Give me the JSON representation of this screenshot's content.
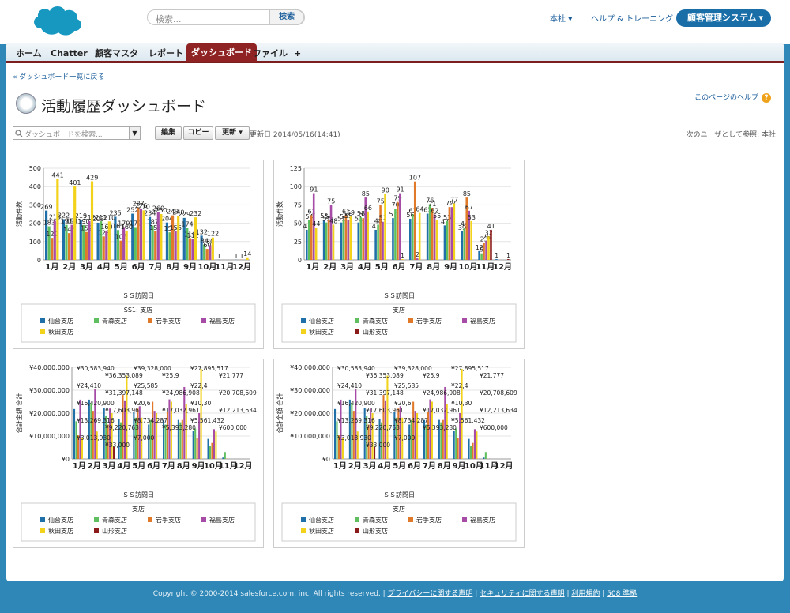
{
  "header": {
    "search_placeholder": "検索...",
    "search_button": "検索",
    "org_menu": "本社",
    "help_link": "ヘルプ & トレーニング",
    "app_switcher": "顧客管理システム"
  },
  "tabs": [
    {
      "label": "ホーム"
    },
    {
      "label": "Chatter"
    },
    {
      "label": "顧客マスタ"
    },
    {
      "label": "レポート"
    },
    {
      "label": "ダッシュボード",
      "active": true
    },
    {
      "label": "ファイル"
    },
    {
      "label": "+"
    }
  ],
  "page": {
    "back_link": "« ダッシュボード一覧に戻る",
    "title": "活動履歴ダッシュボード",
    "help_link": "このページのヘルプ",
    "dash_search_placeholder": "ダッシュボードを検索...",
    "edit_button": "編集",
    "copy_button": "コピー",
    "refresh_button": "更新",
    "updated_text": "更新日 2014/05/16(14:41)",
    "view_as": "次のユーザとして参照: 本社"
  },
  "footer": {
    "copyright": "Copyright © 2000-2014 salesforce.com, inc. All rights reserved.",
    "links": [
      "プライバシーに関する声明",
      "セキュリティに関する声明",
      "利用規約",
      "508 準拠"
    ]
  },
  "colors": {
    "accent": "#8f2323",
    "tab_bar": "#dce8f0",
    "page_bg": "#2f87b7"
  },
  "chart_data": [
    {
      "type": "bar",
      "categories": [
        "1月",
        "2月",
        "3月",
        "4月",
        "5月",
        "6月",
        "7月",
        "8月",
        "9月",
        "10月",
        "11月",
        "12月"
      ],
      "ylabel": "活動件数",
      "xlabel": "ＳＳ訪問日",
      "ylim": [
        0,
        500
      ],
      "yticks": [
        "0",
        "100",
        "200",
        "300",
        "400",
        "500"
      ],
      "legend_title": "SS1: 支店",
      "series": [
        {
          "name": "仙台支店",
          "color": "#1f6fa8",
          "values": [
            269,
            222,
            219,
            203,
            235,
            252,
            234,
            204,
            229,
            132,
            1,
            1
          ]
        },
        {
          "name": "青森支店",
          "color": "#5fbf5f",
          "values": [
            183,
            191,
            190,
            211,
            163,
            179,
            187,
            150,
            174,
            84,
            0,
            0
          ]
        },
        {
          "name": "岩手支店",
          "color": "#e07a2a",
          "values": [
            120,
            146,
            152,
            128,
            105,
            287,
            156,
            243,
            119,
            60,
            0,
            1
          ]
        },
        {
          "name": "福島支店",
          "color": "#a64ca6",
          "values": [
            213,
            191,
            212,
            160,
            179,
            276,
            260,
            156,
            112,
            80,
            0,
            0
          ]
        },
        {
          "name": "秋田支店",
          "color": "#f2d21a",
          "values": [
            441,
            401,
            429,
            210,
            160,
            270,
            250,
            240,
            232,
            122,
            0,
            14
          ]
        }
      ]
    },
    {
      "type": "bar",
      "categories": [
        "1月",
        "2月",
        "3月",
        "4月",
        "5月",
        "6月",
        "7月",
        "8月",
        "9月",
        "10月",
        "11月",
        "12月"
      ],
      "ylabel": "活動件数",
      "xlabel": "ＳＳ訪問日",
      "ylim": [
        0,
        125
      ],
      "yticks": [
        "0",
        "25",
        "50",
        "75",
        "100",
        "125"
      ],
      "legend_title": "支店",
      "series": [
        {
          "name": "仙台支店",
          "color": "#1f6fa8",
          "values": [
            41,
            55,
            51,
            51,
            41,
            57,
            56,
            63,
            47,
            39,
            12,
            1
          ]
        },
        {
          "name": "青森支店",
          "color": "#5fbf5f",
          "values": [
            54,
            51,
            54,
            58,
            48,
            70,
            62,
            76,
            53,
            44,
            9,
            0
          ]
        },
        {
          "name": "岩手支店",
          "color": "#e07a2a",
          "values": [
            61,
            54,
            61,
            57,
            75,
            79,
            107,
            71,
            72,
            85,
            23,
            0
          ]
        },
        {
          "name": "福島支店",
          "color": "#a64ca6",
          "values": [
            91,
            75,
            55,
            85,
            52,
            91,
            2,
            62,
            72,
            67,
            26,
            0
          ]
        },
        {
          "name": "秋田支店",
          "color": "#f2d21a",
          "values": [
            44,
            48,
            59,
            66,
            90,
            1,
            64,
            55,
            77,
            53,
            32,
            0
          ]
        },
        {
          "name": "山形支店",
          "color": "#8b1a1a",
          "values": [
            0,
            0,
            0,
            0,
            0,
            0,
            0,
            0,
            0,
            0,
            41,
            1
          ]
        }
      ]
    },
    {
      "type": "bar",
      "categories": [
        "1月",
        "2月",
        "3月",
        "4月",
        "5月",
        "6月",
        "7月",
        "8月",
        "9月",
        "10月",
        "11月",
        "12月"
      ],
      "ylabel": "合計金額 合計",
      "xlabel": "ＳＳ訪問日",
      "ylim": [
        0,
        40000000
      ],
      "yticks": [
        "¥0",
        "¥10,000,000",
        "¥20,000,000",
        "¥30,000,000",
        "¥40,000,000"
      ],
      "legend_title": "支店",
      "labels": [
        "¥30,583,940",
        "¥36,353,089",
        "¥39,328,000",
        "¥25,9",
        "¥27,895,517",
        "¥21,777",
        "¥24,410",
        "¥31,397,148",
        "¥25,585",
        "¥24,986,908",
        "¥22,4",
        "¥20,708,609",
        "¥16,420,900",
        "¥17,603,961",
        "¥20,6",
        "¥17,032,961",
        "¥10,30",
        "¥12,213,634",
        "¥13,269,316",
        "¥9,220,763",
        "¥8,734,287",
        "¥5,393,280",
        "¥5,561,432",
        "¥600,000",
        "¥3,013,930",
        "¥33,000",
        "¥7,000"
      ],
      "series": [
        {
          "name": "仙台支店",
          "color": "#1f6fa8",
          "values": [
            21777000,
            25900000,
            22400000,
            17600000,
            20600000,
            15000000,
            17000000,
            17032961,
            12213634,
            8734287,
            600000,
            0
          ]
        },
        {
          "name": "青森支店",
          "color": "#5fbf5f",
          "values": [
            16420900,
            24410000,
            19000000,
            16000000,
            18000000,
            17000000,
            15000000,
            16000000,
            13269316,
            5561432,
            3013930,
            0
          ]
        },
        {
          "name": "岩手支店",
          "color": "#e07a2a",
          "values": [
            10300000,
            21000000,
            15000000,
            27895517,
            22000000,
            24986908,
            20708609,
            17000000,
            9220763,
            7000000,
            100000,
            0
          ]
        },
        {
          "name": "福島支店",
          "color": "#a64ca6",
          "values": [
            25900000,
            30583940,
            22000000,
            25585000,
            23000000,
            21000000,
            26000000,
            31397148,
            20000000,
            13000000,
            33000,
            0
          ]
        },
        {
          "name": "秋田支店",
          "color": "#f2d21a",
          "values": [
            9000000,
            12000000,
            20000000,
            36353089,
            18000000,
            20000000,
            25000000,
            24000000,
            39328000,
            12000000,
            7000,
            0
          ]
        },
        {
          "name": "山形支店",
          "color": "#8b1a1a",
          "values": [
            0,
            0,
            5393280,
            0,
            0,
            0,
            0,
            0,
            0,
            0,
            0,
            0
          ]
        }
      ]
    },
    {
      "type": "bar",
      "categories": [
        "1月",
        "2月",
        "3月",
        "4月",
        "5月",
        "6月",
        "7月",
        "8月",
        "9月",
        "10月",
        "11月",
        "12月"
      ],
      "ylabel": "合計金額 合計",
      "xlabel": "ＳＳ訪問日",
      "ylim": [
        0,
        40000000
      ],
      "yticks": [
        "¥0",
        "¥10,000,000",
        "¥20,000,000",
        "¥30,000,000",
        "¥40,000,000"
      ],
      "legend_title": "支店",
      "labels": [
        "¥30,583,940",
        "¥36,353,089",
        "¥39,328,000",
        "¥25,9",
        "¥27,895,517",
        "¥21,777",
        "¥24,410",
        "¥31,397,148",
        "¥25,585",
        "¥24,986,908",
        "¥22,4",
        "¥20,708,609",
        "¥16,420,900",
        "¥17,603,961",
        "¥20,6",
        "¥17,032,961",
        "¥10,30",
        "¥12,213,634",
        "¥13,269,316",
        "¥9,220,763",
        "¥8,734,287",
        "¥5,393,280",
        "¥5,561,432",
        "¥600,000",
        "¥3,013,930",
        "¥33,000",
        "¥7,000"
      ],
      "series": [
        {
          "name": "仙台支店",
          "color": "#1f6fa8",
          "values": [
            21777000,
            25900000,
            22400000,
            17600000,
            20600000,
            15000000,
            17000000,
            17032961,
            12213634,
            8734287,
            600000,
            0
          ]
        },
        {
          "name": "青森支店",
          "color": "#5fbf5f",
          "values": [
            16420900,
            24410000,
            19000000,
            16000000,
            18000000,
            17000000,
            15000000,
            16000000,
            13269316,
            5561432,
            3013930,
            0
          ]
        },
        {
          "name": "岩手支店",
          "color": "#e07a2a",
          "values": [
            10300000,
            21000000,
            15000000,
            27895517,
            22000000,
            24986908,
            20708609,
            17000000,
            9220763,
            7000000,
            100000,
            0
          ]
        },
        {
          "name": "福島支店",
          "color": "#a64ca6",
          "values": [
            25900000,
            30583940,
            22000000,
            25585000,
            23000000,
            21000000,
            26000000,
            31397148,
            20000000,
            13000000,
            33000,
            0
          ]
        },
        {
          "name": "秋田支店",
          "color": "#f2d21a",
          "values": [
            9000000,
            12000000,
            20000000,
            36353089,
            18000000,
            20000000,
            25000000,
            24000000,
            39328000,
            12000000,
            7000,
            0
          ]
        },
        {
          "name": "山形支店",
          "color": "#8b1a1a",
          "values": [
            0,
            0,
            5393280,
            0,
            0,
            0,
            0,
            0,
            0,
            0,
            0,
            0
          ]
        }
      ]
    }
  ]
}
